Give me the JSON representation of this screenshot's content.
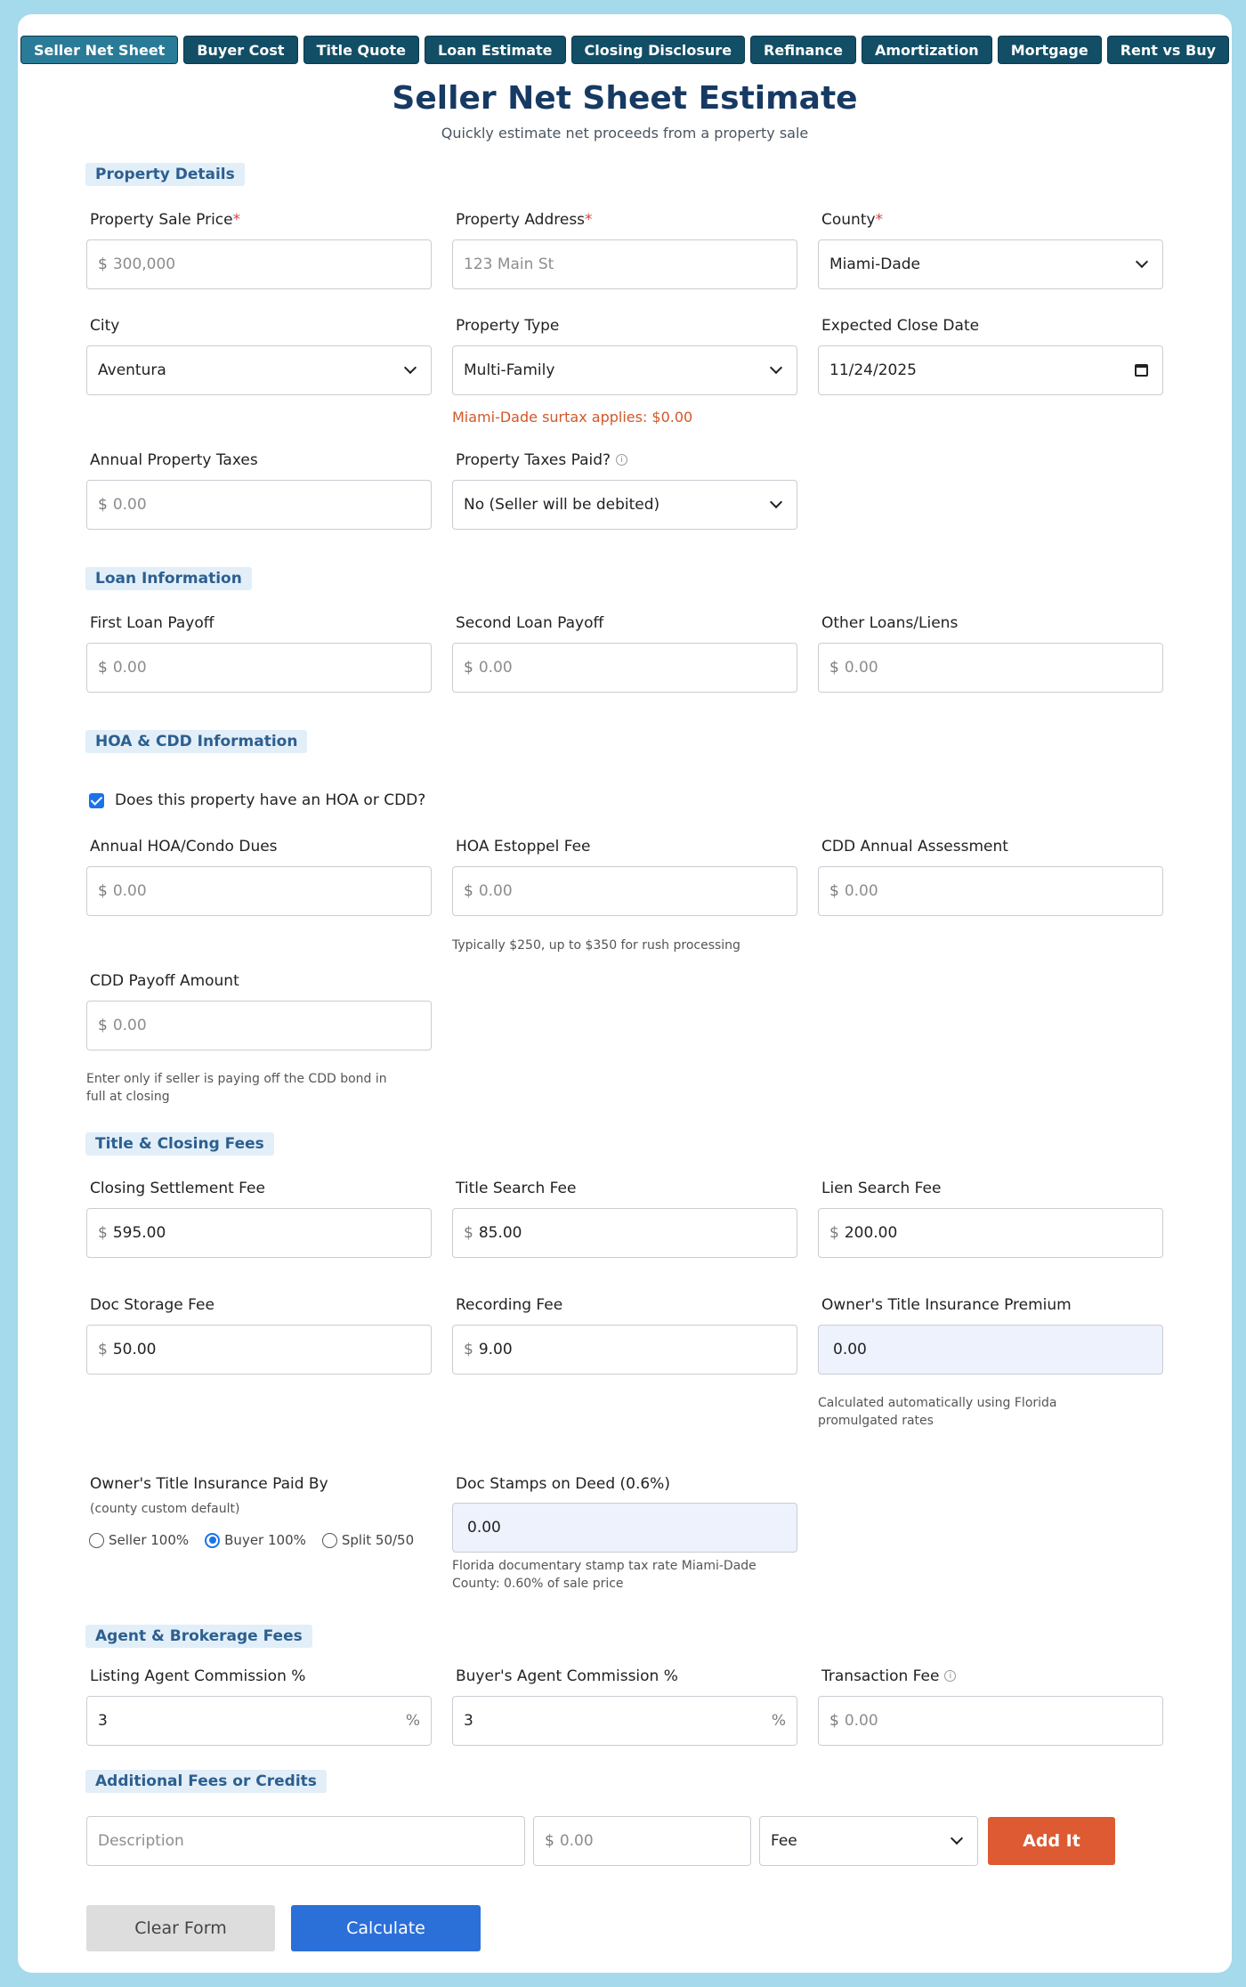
{
  "tabs": [
    "Seller Net Sheet",
    "Buyer Cost",
    "Title Quote",
    "Loan Estimate",
    "Closing Disclosure",
    "Refinance",
    "Amortization",
    "Mortgage",
    "Rent vs Buy"
  ],
  "header": {
    "title": "Seller Net Sheet Estimate",
    "subtitle": "Quickly estimate net proceeds from a property sale"
  },
  "sections": {
    "property": "Property Details",
    "loan": "Loan Information",
    "hoa": "HOA & CDD Information",
    "title_fees": "Title & Closing Fees",
    "agent": "Agent & Brokerage Fees",
    "additional": "Additional Fees or Credits"
  },
  "property": {
    "sale_price": {
      "label": "Property Sale Price",
      "required": "*",
      "prefix": "$",
      "placeholder": "300,000"
    },
    "address": {
      "label": "Property Address",
      "required": "*",
      "placeholder": "123 Main St"
    },
    "county": {
      "label": "County",
      "required": "*",
      "value": "Miami-Dade"
    },
    "city": {
      "label": "City",
      "value": "Aventura"
    },
    "type": {
      "label": "Property Type",
      "value": "Multi-Family",
      "note": "Miami-Dade surtax applies: $0.00"
    },
    "close_date": {
      "label": "Expected Close Date",
      "value": "11/24/2025"
    },
    "annual_taxes": {
      "label": "Annual Property Taxes",
      "prefix": "$",
      "placeholder": "0.00"
    },
    "taxes_paid": {
      "label": "Property Taxes Paid?",
      "info": "i",
      "value": "No (Seller will be debited)"
    }
  },
  "loan": {
    "first": {
      "label": "First Loan Payoff",
      "prefix": "$",
      "placeholder": "0.00"
    },
    "second": {
      "label": "Second Loan Payoff",
      "prefix": "$",
      "placeholder": "0.00"
    },
    "other": {
      "label": "Other Loans/Liens",
      "prefix": "$",
      "placeholder": "0.00"
    }
  },
  "hoa": {
    "has_hoa": {
      "label": "Does this property have an HOA or CDD?",
      "checked": true
    },
    "dues": {
      "label": "Annual HOA/Condo Dues",
      "prefix": "$",
      "placeholder": "0.00"
    },
    "estoppel": {
      "label": "HOA Estoppel Fee",
      "prefix": "$",
      "placeholder": "0.00",
      "help": "Typically $250, up to $350 for rush processing"
    },
    "cdd_annual": {
      "label": "CDD Annual Assessment",
      "prefix": "$",
      "placeholder": "0.00"
    },
    "cdd_payoff": {
      "label": "CDD Payoff Amount",
      "prefix": "$",
      "placeholder": "0.00",
      "help_line1": "Enter only if seller is paying off the CDD bond in",
      "help_line2": "full at closing"
    }
  },
  "title_fees": {
    "settlement": {
      "label": "Closing Settlement Fee",
      "prefix": "$",
      "value": "595.00"
    },
    "search": {
      "label": "Title Search Fee",
      "prefix": "$",
      "value": "85.00"
    },
    "lien": {
      "label": "Lien Search Fee",
      "prefix": "$",
      "value": "200.00"
    },
    "storage": {
      "label": "Doc Storage Fee",
      "prefix": "$",
      "value": "50.00"
    },
    "recording": {
      "label": "Recording Fee",
      "prefix": "$",
      "value": "9.00"
    },
    "owners_premium": {
      "label": "Owner's Title Insurance Premium",
      "value": "0.00",
      "help_line1": "Calculated automatically using Florida",
      "help_line2": "promulgated rates"
    },
    "paid_by": {
      "label": "Owner's Title Insurance Paid By",
      "sub": "(county custom default)",
      "options": [
        "Seller 100%",
        "Buyer 100%",
        "Split 50/50"
      ],
      "selected": "Buyer 100%"
    },
    "doc_stamps": {
      "label": "Doc Stamps on Deed (0.6%)",
      "value": "0.00",
      "help_line1": "Florida documentary stamp tax rate Miami-Dade",
      "help_line2": "County: 0.60% of sale price"
    }
  },
  "agent": {
    "listing": {
      "label": "Listing Agent Commission %",
      "value": "3",
      "suffix": "%"
    },
    "buyers": {
      "label": "Buyer's Agent Commission %",
      "value": "3",
      "suffix": "%"
    },
    "transaction": {
      "label": "Transaction Fee",
      "info": "i",
      "prefix": "$",
      "placeholder": "0.00"
    }
  },
  "additional": {
    "description_placeholder": "Description",
    "amount_prefix": "$",
    "amount_placeholder": "0.00",
    "type_value": "Fee",
    "add_label": "Add It"
  },
  "actions": {
    "clear": "Clear Form",
    "calculate": "Calculate"
  }
}
